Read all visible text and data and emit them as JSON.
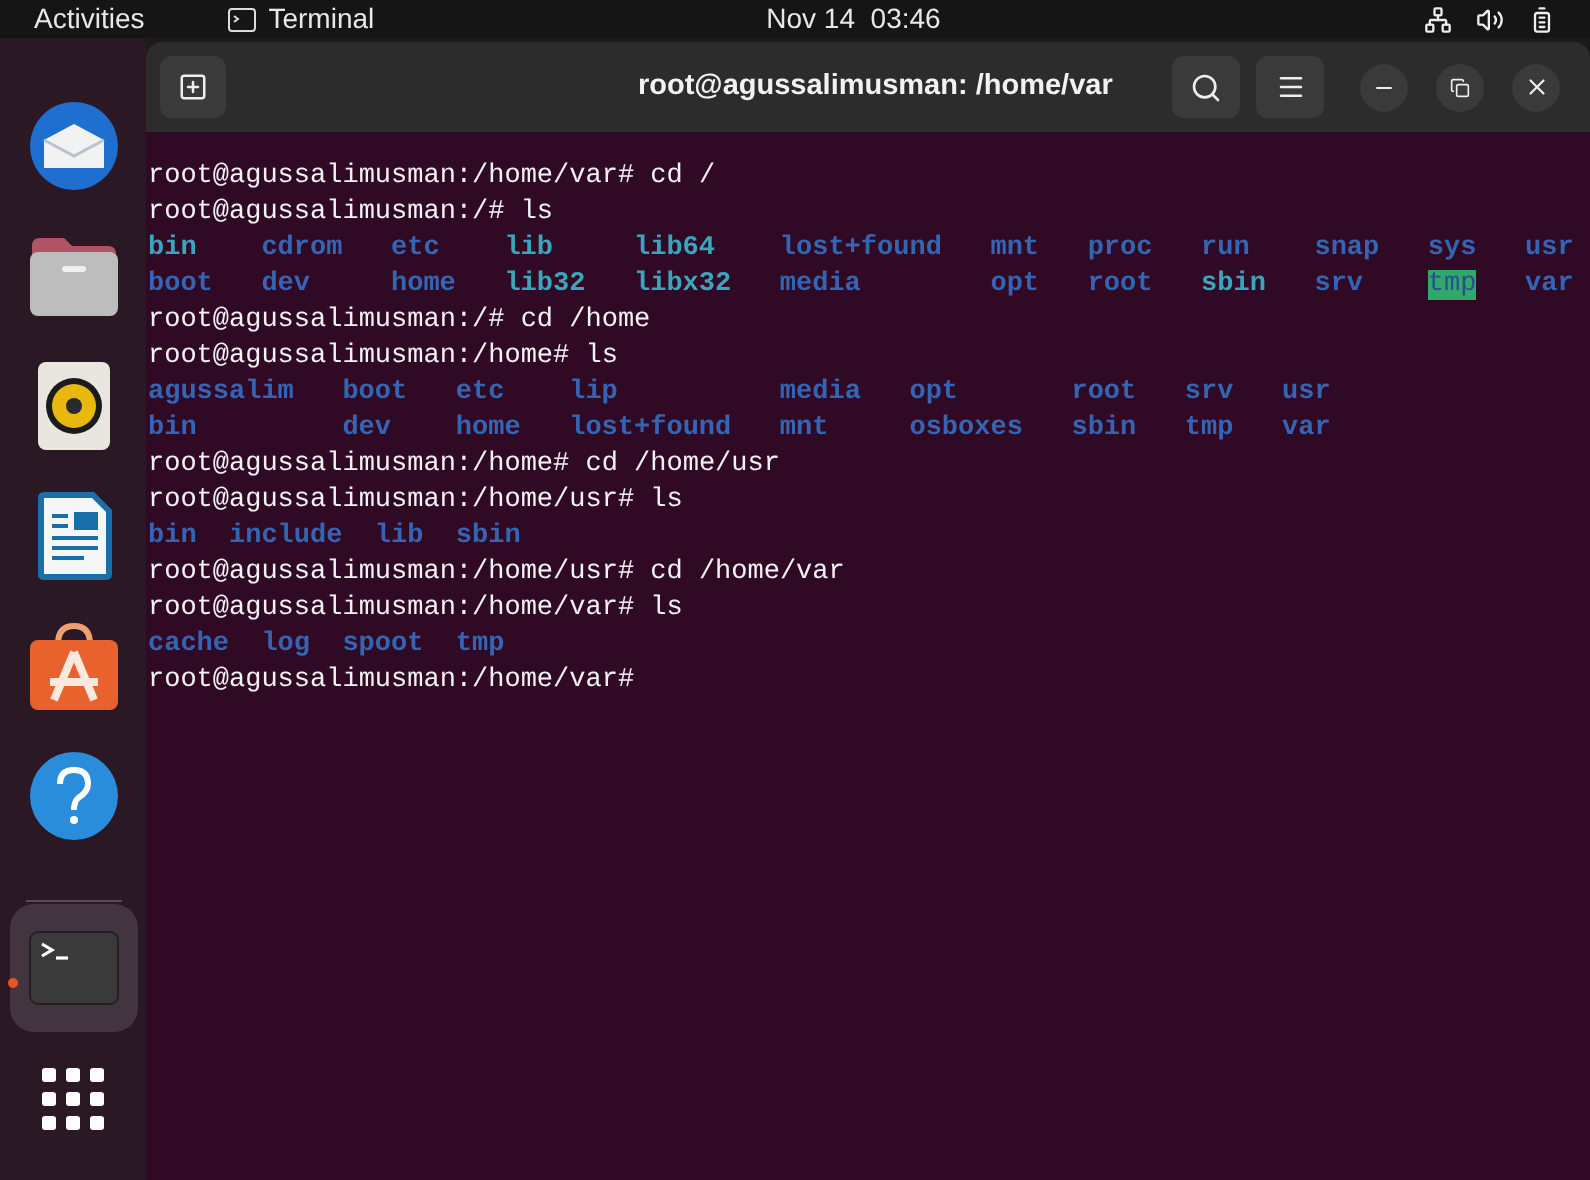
{
  "topbar": {
    "activities": "Activities",
    "app_name": "Terminal",
    "clock": "Nov 14  03:46"
  },
  "dock": {
    "items": [
      {
        "kind": "mail",
        "running": false,
        "selected": false
      },
      {
        "kind": "files",
        "running": false,
        "selected": false
      },
      {
        "kind": "music",
        "running": false,
        "selected": false
      },
      {
        "kind": "writer",
        "running": false,
        "selected": false
      },
      {
        "kind": "store",
        "running": false,
        "selected": false
      },
      {
        "kind": "help",
        "running": false,
        "selected": false
      },
      {
        "kind": "terminal",
        "running": true,
        "selected": true
      }
    ]
  },
  "terminal": {
    "title": "root@agussalimusman: /home/var",
    "lines": [
      {
        "kind": "prompt",
        "text": "root@agussalimusman:/home/var# cd /"
      },
      {
        "kind": "prompt",
        "text": "root@agussalimusman:/# ls"
      },
      {
        "kind": "listing",
        "rows": [
          [
            {
              "text": "bin",
              "kind": "link"
            },
            {
              "text": "cdrom",
              "kind": "dir"
            },
            {
              "text": "etc",
              "kind": "dir"
            },
            {
              "text": "lib",
              "kind": "link"
            },
            {
              "text": "lib64",
              "kind": "link"
            },
            {
              "text": "lost+found",
              "kind": "dir"
            },
            {
              "text": "mnt",
              "kind": "dir"
            },
            {
              "text": "proc",
              "kind": "dir"
            },
            {
              "text": "run",
              "kind": "dir"
            },
            {
              "text": "snap",
              "kind": "dir"
            },
            {
              "text": "sys",
              "kind": "dir"
            },
            {
              "text": "usr",
              "kind": "dir"
            }
          ],
          [
            {
              "text": "boot",
              "kind": "dir"
            },
            {
              "text": "dev",
              "kind": "dir"
            },
            {
              "text": "home",
              "kind": "dir"
            },
            {
              "text": "lib32",
              "kind": "link"
            },
            {
              "text": "libx32",
              "kind": "link"
            },
            {
              "text": "media",
              "kind": "dir"
            },
            {
              "text": "opt",
              "kind": "dir"
            },
            {
              "text": "root",
              "kind": "dir"
            },
            {
              "text": "sbin",
              "kind": "link"
            },
            {
              "text": "srv",
              "kind": "dir"
            },
            {
              "text": "tmp",
              "kind": "sticky"
            },
            {
              "text": "var",
              "kind": "dir"
            }
          ]
        ]
      },
      {
        "kind": "prompt",
        "text": "root@agussalimusman:/# cd /home"
      },
      {
        "kind": "prompt",
        "text": "root@agussalimusman:/home# ls"
      },
      {
        "kind": "listing",
        "rows": [
          [
            {
              "text": "agussalim",
              "kind": "dir"
            },
            {
              "text": "boot",
              "kind": "dir"
            },
            {
              "text": "etc",
              "kind": "dir"
            },
            {
              "text": "lip",
              "kind": "dir"
            },
            {
              "text": "media",
              "kind": "dir"
            },
            {
              "text": "opt",
              "kind": "dir"
            },
            {
              "text": "root",
              "kind": "dir"
            },
            {
              "text": "srv",
              "kind": "dir"
            },
            {
              "text": "usr",
              "kind": "dir"
            }
          ],
          [
            {
              "text": "bin",
              "kind": "dir"
            },
            {
              "text": "dev",
              "kind": "dir"
            },
            {
              "text": "home",
              "kind": "dir"
            },
            {
              "text": "lost+found",
              "kind": "dir"
            },
            {
              "text": "mnt",
              "kind": "dir"
            },
            {
              "text": "osboxes",
              "kind": "dir"
            },
            {
              "text": "sbin",
              "kind": "dir"
            },
            {
              "text": "tmp",
              "kind": "dir"
            },
            {
              "text": "var",
              "kind": "dir"
            }
          ]
        ]
      },
      {
        "kind": "prompt",
        "text": "root@agussalimusman:/home# cd /home/usr"
      },
      {
        "kind": "prompt",
        "text": "root@agussalimusman:/home/usr# ls"
      },
      {
        "kind": "listing",
        "rows": [
          [
            {
              "text": "bin",
              "kind": "dir"
            },
            {
              "text": "include",
              "kind": "dir"
            },
            {
              "text": "lib",
              "kind": "dir"
            },
            {
              "text": "sbin",
              "kind": "dir"
            }
          ]
        ]
      },
      {
        "kind": "prompt",
        "text": "root@agussalimusman:/home/usr# cd /home/var"
      },
      {
        "kind": "prompt",
        "text": "root@agussalimusman:/home/var# ls"
      },
      {
        "kind": "listing",
        "rows": [
          [
            {
              "text": "cache",
              "kind": "dir"
            },
            {
              "text": "log",
              "kind": "dir"
            },
            {
              "text": "spoot",
              "kind": "dir"
            },
            {
              "text": "tmp",
              "kind": "dir"
            }
          ]
        ]
      },
      {
        "kind": "prompt",
        "text": "root@agussalimusman:/home/var#"
      }
    ]
  }
}
